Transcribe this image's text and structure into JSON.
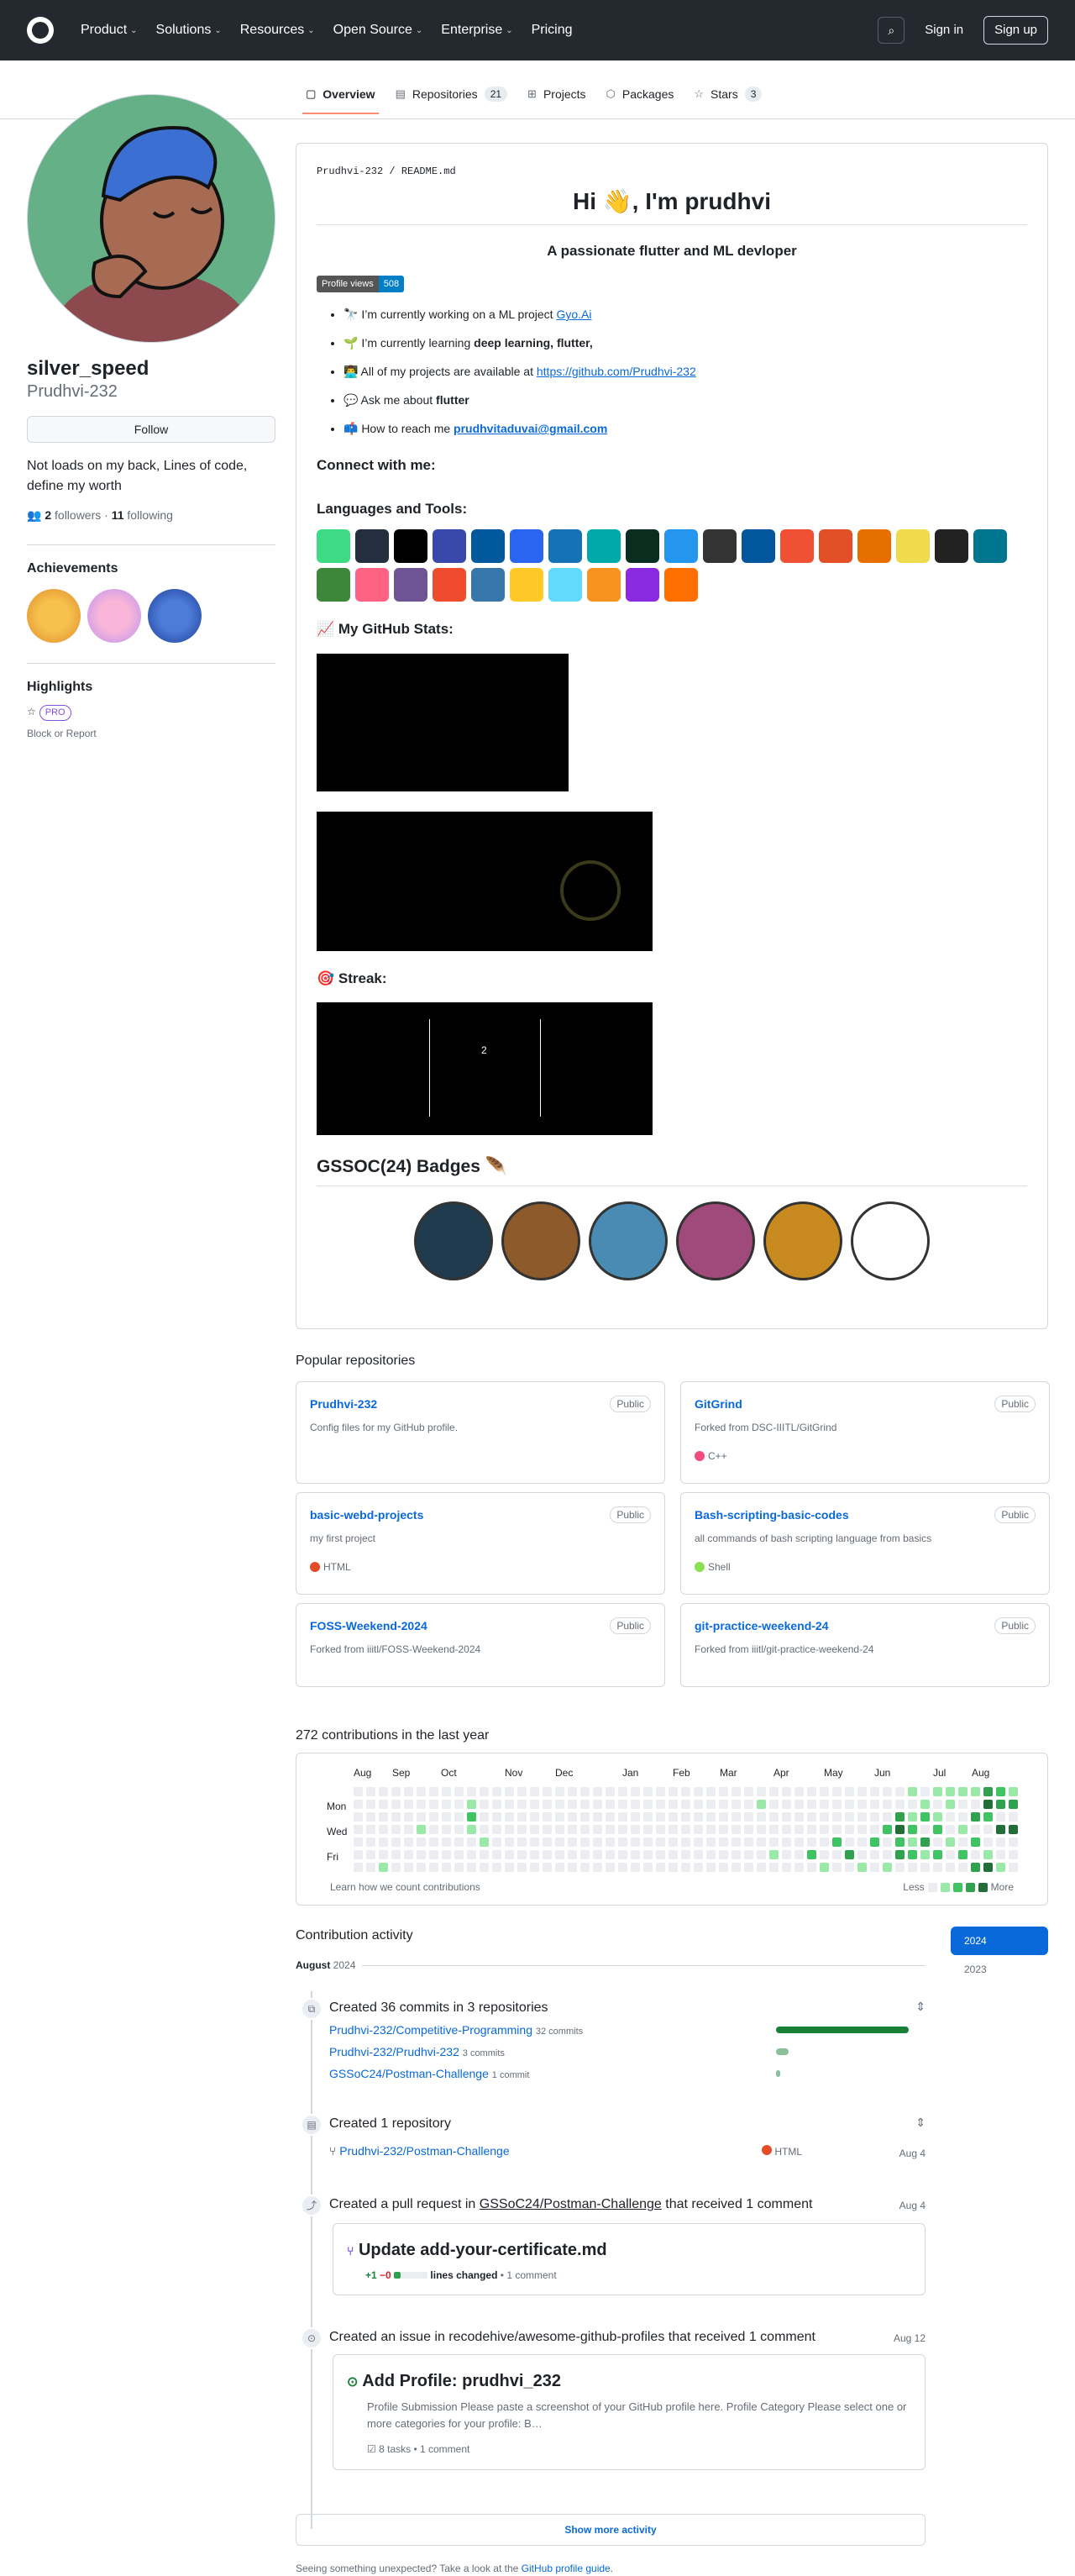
{
  "header": {
    "nav": [
      "Product",
      "Solutions",
      "Resources",
      "Open Source",
      "Enterprise",
      "Pricing"
    ],
    "signin": "Sign in",
    "signup": "Sign up"
  },
  "tabs": [
    {
      "label": "Overview",
      "count": ""
    },
    {
      "label": "Repositories",
      "count": "21"
    },
    {
      "label": "Projects",
      "count": ""
    },
    {
      "label": "Packages",
      "count": ""
    },
    {
      "label": "Stars",
      "count": "3"
    }
  ],
  "profile": {
    "name": "silver_speed",
    "login": "Prudhvi-232",
    "follow": "Follow",
    "bio": "Not loads on my back, Lines of code, define my worth",
    "followers": "2",
    "followers_label": "followers",
    "following": "11",
    "following_label": "following",
    "achievements": "Achievements",
    "highlights": "Highlights",
    "pro": "PRO",
    "block": "Block or Report"
  },
  "readme": {
    "path_user": "Prudhvi-232",
    "path_file": "README.md",
    "title": "Hi 👋, I'm prudhvi",
    "subtitle": "A passionate flutter and ML devloper",
    "views_label": "Profile views",
    "views": "508",
    "items": [
      {
        "pre": "🔭 I’m currently working on a ML project ",
        "link": "Gyo.Ai",
        "post": ""
      },
      {
        "pre": "🌱 I’m currently learning ",
        "bold": "deep learning, flutter,",
        "post": ""
      },
      {
        "pre": "👨‍💻 All of my projects are available at ",
        "link": "https://github.com/Prudhvi-232",
        "post": ""
      },
      {
        "pre": "💬 Ask me about ",
        "bold": "flutter",
        "post": ""
      },
      {
        "pre": "📫 How to reach me ",
        "link": "prudhvitaduvai@gmail.com",
        "post": ""
      }
    ],
    "connect": "Connect with me:",
    "languages": "Languages and Tools:",
    "stats": "📈 My GitHub Stats:",
    "streak": "🎯 Streak:",
    "streak_num": "2",
    "gssoc": "GSSOC(24) Badges 🪶",
    "tool_colors": [
      "#3ddc84",
      "#232f3e",
      "#000000",
      "#3949ab",
      "#00599c",
      "#2965f1",
      "#1572b6",
      "#0aa",
      "#092e20",
      "#2496ed",
      "#333333",
      "#02569b",
      "#f05033",
      "#e34f26",
      "#e76f00",
      "#f0db4f",
      "#222",
      "#00758f",
      "#3c873a",
      "#ff6384",
      "#6e5494",
      "#ee4c2c",
      "#3776ab",
      "#ffca28",
      "#61dafb",
      "#f7931e",
      "#8a2be2",
      "#ff6f00"
    ],
    "badge_colors": [
      "#1f3b4d",
      "#8c5a2b",
      "#4a8bb3",
      "#a04a7c",
      "#c88a1e",
      "#ffffff"
    ]
  },
  "popular": {
    "title": "Popular repositories",
    "repos": [
      {
        "name": "Prudhvi-232",
        "desc": "Config files for my GitHub profile.",
        "lang": "",
        "lang_color": "",
        "public": "Public"
      },
      {
        "name": "GitGrind",
        "desc": "Forked from DSC-IIITL/GitGrind",
        "lang": "C++",
        "lang_color": "#f34b7d",
        "public": "Public"
      },
      {
        "name": "basic-webd-projects",
        "desc": "my first project",
        "lang": "HTML",
        "lang_color": "#e34c26",
        "public": "Public"
      },
      {
        "name": "Bash-scripting-basic-codes",
        "desc": "all commands of bash scripting language from basics",
        "lang": "Shell",
        "lang_color": "#89e051",
        "public": "Public"
      },
      {
        "name": "FOSS-Weekend-2024",
        "desc": "Forked from iiitl/FOSS-Weekend-2024",
        "lang": "",
        "lang_color": "",
        "public": "Public"
      },
      {
        "name": "git-practice-weekend-24",
        "desc": "Forked from iiitl/git-practice-weekend-24",
        "lang": "",
        "lang_color": "",
        "public": "Public"
      }
    ]
  },
  "contrib": {
    "title": "272 contributions in the last year",
    "months": [
      "Aug",
      "Sep",
      "Oct",
      "Nov",
      "Dec",
      "Jan",
      "Feb",
      "Mar",
      "Apr",
      "May",
      "Jun",
      "Jul",
      "Aug"
    ],
    "days": [
      "Mon",
      "Wed",
      "Fri"
    ],
    "learn": "Learn how we count contributions",
    "less": "Less",
    "more": "More"
  },
  "activity": {
    "title": "Contribution activity",
    "month": "August",
    "year": "2024",
    "years": [
      "2024",
      "2023"
    ],
    "commits": {
      "text": "Created 36 commits in 3 repositories",
      "rows": [
        {
          "repo": "Prudhvi-232/Competitive-Programming",
          "n": "32 commits",
          "v": 32
        },
        {
          "repo": "Prudhvi-232/Prudhvi-232",
          "n": "3 commits",
          "v": 3
        },
        {
          "repo": "GSSoC24/Postman-Challenge",
          "n": "1 commit",
          "v": 1
        }
      ]
    },
    "repo": {
      "text": "Created 1 repository",
      "name": "Prudhvi-232/Postman-Challenge",
      "lang": "HTML",
      "date": "Aug 4"
    },
    "pr": {
      "pre": "Created a pull request in ",
      "link": "GSSoC24/Postman-Challenge",
      "post": " that received 1 comment",
      "date": "Aug 4",
      "title": "Update add-your-certificate.md",
      "add": "+1",
      "del": "−0",
      "changed": "lines changed",
      "comments": "• 1 comment"
    },
    "issue": {
      "text": "Created an issue in recodehive/awesome-github-profiles that received 1 comment",
      "date": "Aug 12",
      "title": "Add Profile: prudhvi_232",
      "body": "Profile Submission Please paste a screenshot of your GitHub profile here. Profile Category Please select one or more categories for your profile: B…",
      "tasks": "8 tasks",
      "comments": "• 1 comment"
    },
    "show_more": "Show more activity",
    "footer_pre": "Seeing something unexpected? Take a look at the ",
    "footer_link": "GitHub profile guide",
    "footer_post": "."
  }
}
